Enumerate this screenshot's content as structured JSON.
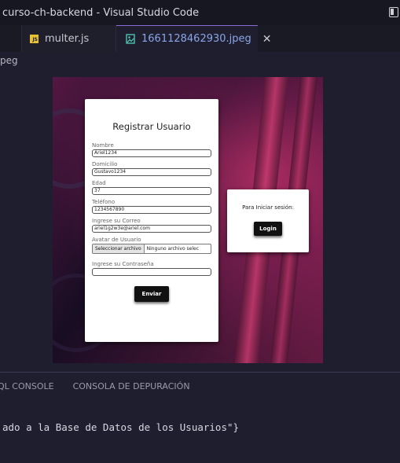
{
  "window": {
    "title": "curso-ch-backend - Visual Studio Code"
  },
  "tabs": [
    {
      "label": "multer.js",
      "icon": "js-file-icon"
    },
    {
      "label": "1661128462930.jpeg",
      "icon": "image-file-icon"
    }
  ],
  "breadcrumb": "peg",
  "preview": {
    "register": {
      "title": "Registrar Usuario",
      "fields": [
        {
          "label": "Nombre",
          "value": "Ariel1234"
        },
        {
          "label": "Domicilio",
          "value": "Gustavo1234"
        },
        {
          "label": "Edad",
          "value": "37"
        },
        {
          "label": "Teléfono",
          "value": "1234567890"
        },
        {
          "label": "Ingrese su Correo",
          "value": "ariel1g2w3e@ariel.com"
        }
      ],
      "avatar_label": "Avatar de Usuario",
      "file_button": "Seleccionar archivo",
      "file_status": "Ninguno archivo selec",
      "password_label": "Ingrese su Contraseña",
      "password_value": "",
      "submit": "Enviar"
    },
    "login": {
      "text": "Para Iniciar sesión:",
      "button": "Login"
    }
  },
  "panel": {
    "tabs": [
      "QL CONSOLE",
      "CONSOLA DE DEPURACIÓN"
    ],
    "terminal_line": "ado a la Base de Datos de los Usuarios\"}"
  },
  "colors": {
    "accent": "#8a6cd6",
    "active_tab_text": "#8aa6e8",
    "editor_bg": "#1e1e2e"
  }
}
